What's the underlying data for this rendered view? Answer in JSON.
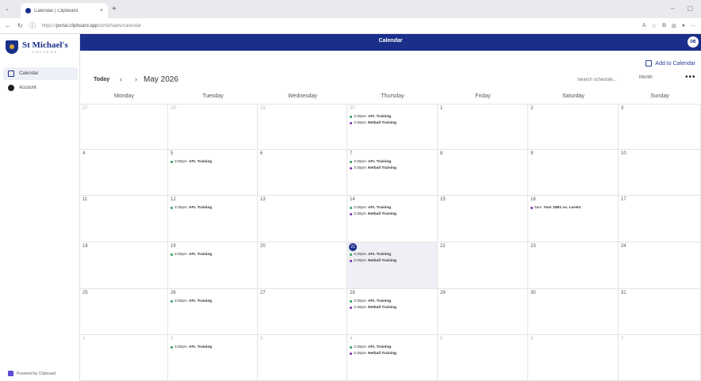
{
  "browser": {
    "tab_title": "Calendar | Clipboard",
    "url_prefix": "https://",
    "url_host": "portal.clipboard.app",
    "url_path": "/stmichaels/calendar",
    "new_tab": "+",
    "tab_close": "×"
  },
  "sidebar": {
    "logo_name": "St Michael's",
    "logo_sub": "COLLEGE",
    "items": [
      {
        "label": "Calendar",
        "icon": "calendar-icon"
      },
      {
        "label": "Account",
        "icon": "account-icon"
      }
    ],
    "powered_by": "Powered by Clipboard"
  },
  "header": {
    "title": "Calendar",
    "avatar_initials": "DB"
  },
  "toolbar": {
    "add_to_calendar": "Add to Calendar",
    "today": "Today",
    "prev": "‹",
    "next": "›",
    "month": "May 2026",
    "search_placeholder": "Search schedule...",
    "view": "Month",
    "more": "•••"
  },
  "calendar": {
    "weekdays": [
      "Monday",
      "Tuesday",
      "Wednesday",
      "Thursday",
      "Friday",
      "Saturday",
      "Sunday"
    ],
    "colors": {
      "afl": "#2e9e5b",
      "netball": "#7a2fb0",
      "game": "#7a2fb0",
      "today": "#1a2f8a"
    },
    "weeks": [
      [
        {
          "day": "27",
          "other": true,
          "events": []
        },
        {
          "day": "28",
          "other": true,
          "events": []
        },
        {
          "day": "29",
          "other": true,
          "events": []
        },
        {
          "day": "30",
          "other": true,
          "events": [
            {
              "time": "3:30pm",
              "title": "AFL Training",
              "kind": "afl"
            },
            {
              "time": "3:30pm",
              "title": "Netball Training",
              "kind": "netball"
            }
          ]
        },
        {
          "day": "1",
          "other": false,
          "events": []
        },
        {
          "day": "2",
          "other": false,
          "events": []
        },
        {
          "day": "3",
          "other": false,
          "events": []
        }
      ],
      [
        {
          "day": "4",
          "other": false,
          "events": []
        },
        {
          "day": "5",
          "other": false,
          "events": [
            {
              "time": "3:30pm",
              "title": "AFL Training",
              "kind": "afl"
            }
          ]
        },
        {
          "day": "6",
          "other": false,
          "events": []
        },
        {
          "day": "7",
          "other": false,
          "events": [
            {
              "time": "3:30pm",
              "title": "AFL Training",
              "kind": "afl"
            },
            {
              "time": "3:30pm",
              "title": "Netball Training",
              "kind": "netball"
            }
          ]
        },
        {
          "day": "8",
          "other": false,
          "events": []
        },
        {
          "day": "9",
          "other": false,
          "events": []
        },
        {
          "day": "10",
          "other": false,
          "events": []
        }
      ],
      [
        {
          "day": "11",
          "other": false,
          "events": []
        },
        {
          "day": "12",
          "other": false,
          "events": [
            {
              "time": "3:30pm",
              "title": "AFL Training",
              "kind": "afl"
            }
          ]
        },
        {
          "day": "13",
          "other": false,
          "events": []
        },
        {
          "day": "14",
          "other": false,
          "events": [
            {
              "time": "3:30pm",
              "title": "AFL Training",
              "kind": "afl"
            },
            {
              "time": "3:30pm",
              "title": "Netball Training",
              "kind": "netball"
            }
          ]
        },
        {
          "day": "15",
          "other": false,
          "events": []
        },
        {
          "day": "16",
          "other": false,
          "events": [
            {
              "time": "9am",
              "title": "Year 10B1 vs. Loreto",
              "kind": "game"
            }
          ]
        },
        {
          "day": "17",
          "other": false,
          "events": []
        }
      ],
      [
        {
          "day": "18",
          "other": false,
          "events": []
        },
        {
          "day": "19",
          "other": false,
          "events": [
            {
              "time": "3:30pm",
              "title": "AFL Training",
              "kind": "afl"
            }
          ]
        },
        {
          "day": "20",
          "other": false,
          "events": []
        },
        {
          "day": "21",
          "other": false,
          "today": true,
          "events": [
            {
              "time": "3:30pm",
              "title": "AFL Training",
              "kind": "afl"
            },
            {
              "time": "3:30pm",
              "title": "Netball Training",
              "kind": "netball"
            }
          ]
        },
        {
          "day": "22",
          "other": false,
          "events": []
        },
        {
          "day": "23",
          "other": false,
          "events": []
        },
        {
          "day": "24",
          "other": false,
          "events": []
        }
      ],
      [
        {
          "day": "25",
          "other": false,
          "events": []
        },
        {
          "day": "26",
          "other": false,
          "events": [
            {
              "time": "3:30pm",
              "title": "AFL Training",
              "kind": "afl"
            }
          ]
        },
        {
          "day": "27",
          "other": false,
          "events": []
        },
        {
          "day": "28",
          "other": false,
          "events": [
            {
              "time": "3:30pm",
              "title": "AFL Training",
              "kind": "afl"
            },
            {
              "time": "3:30pm",
              "title": "Netball Training",
              "kind": "netball"
            }
          ]
        },
        {
          "day": "29",
          "other": false,
          "events": []
        },
        {
          "day": "30",
          "other": false,
          "events": []
        },
        {
          "day": "31",
          "other": false,
          "events": []
        }
      ],
      [
        {
          "day": "1",
          "other": true,
          "events": []
        },
        {
          "day": "2",
          "other": true,
          "events": [
            {
              "time": "3:30pm",
              "title": "AFL Training",
              "kind": "afl"
            }
          ]
        },
        {
          "day": "3",
          "other": true,
          "events": []
        },
        {
          "day": "4",
          "other": true,
          "events": [
            {
              "time": "3:30pm",
              "title": "AFL Training",
              "kind": "afl"
            },
            {
              "time": "3:30pm",
              "title": "Netball Training",
              "kind": "netball"
            }
          ]
        },
        {
          "day": "5",
          "other": true,
          "events": []
        },
        {
          "day": "6",
          "other": true,
          "events": []
        },
        {
          "day": "7",
          "other": true,
          "events": []
        }
      ]
    ]
  }
}
